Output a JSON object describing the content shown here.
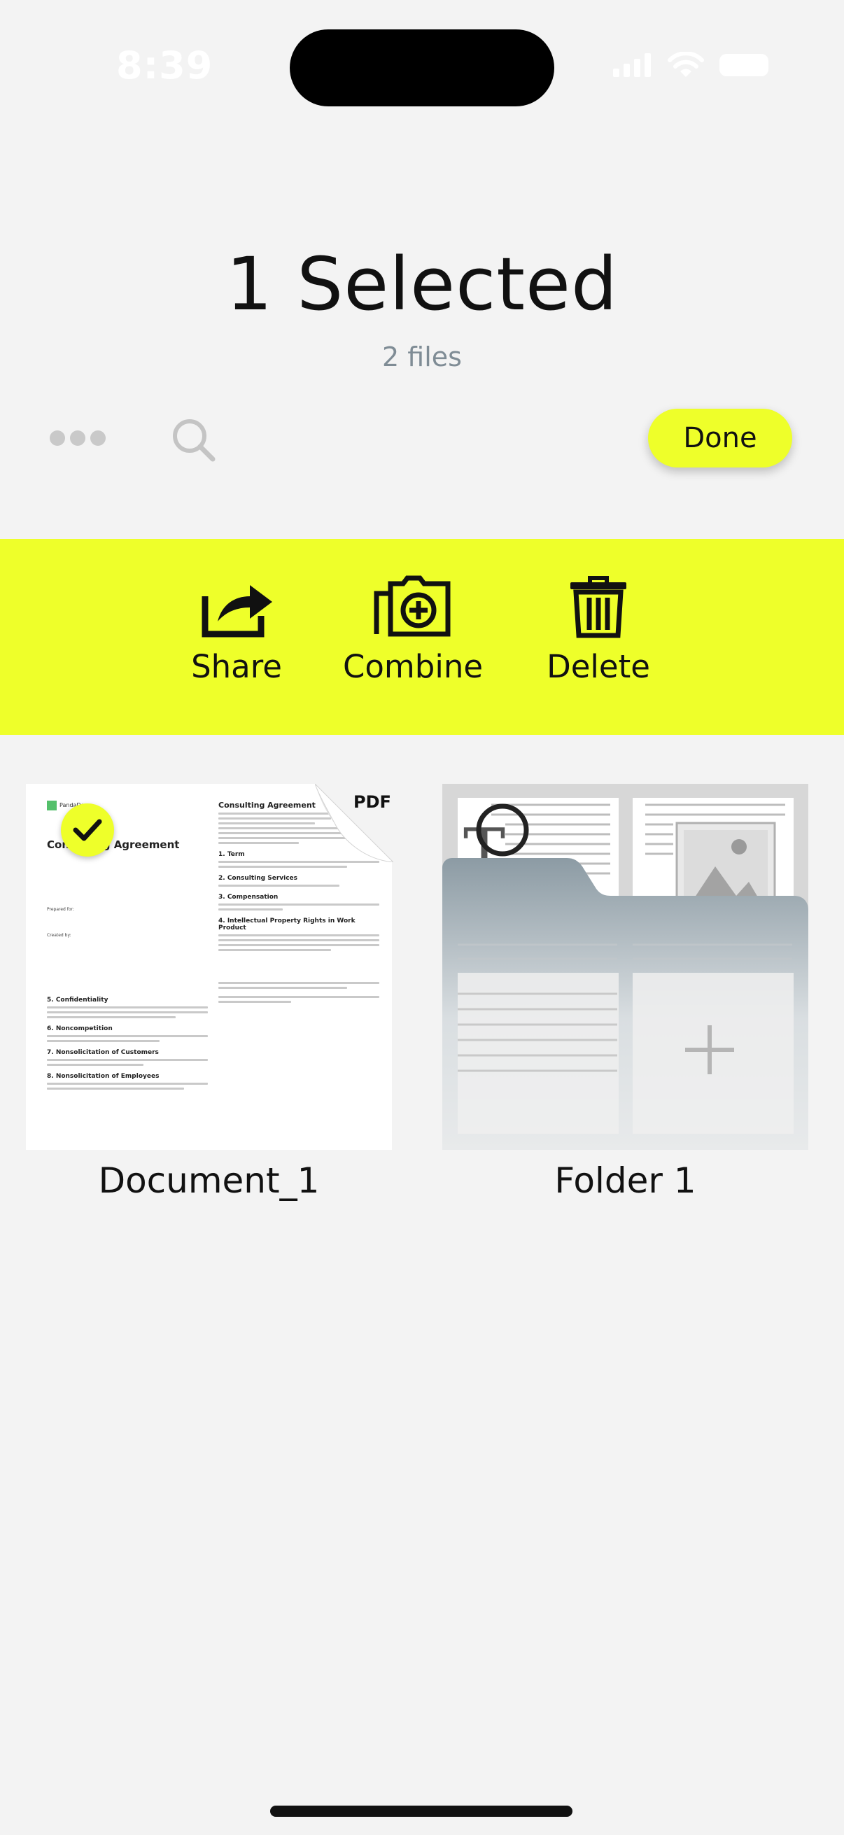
{
  "status_bar": {
    "time": "8:39"
  },
  "header": {
    "title": "1 Selected",
    "subtitle": "2 files"
  },
  "toolbar": {
    "more_icon": "ellipsis-icon",
    "search_icon": "search-icon",
    "done_label": "Done"
  },
  "actions": [
    {
      "label": "Share",
      "icon": "share-icon"
    },
    {
      "label": "Combine",
      "icon": "combine-icon"
    },
    {
      "label": "Delete",
      "icon": "trash-icon"
    }
  ],
  "items": [
    {
      "name": "Document_1",
      "badge": "PDF",
      "selected": true,
      "thumbnail": {
        "logo_text": "PandaDoc",
        "title_left": "Consulting Agreement",
        "prepared_for": "Prepared for:",
        "created_by": "Created by:",
        "title_right": "Consulting Agreement",
        "sections_right": [
          "1. Term",
          "2. Consulting Services",
          "3. Compensation",
          "4. Intellectual Property Rights in Work Product"
        ],
        "sections_left": [
          "5. Confidentiality",
          "6. Noncompetition",
          "7. Nonsolicitation of Customers",
          "8. Nonsolicitation of Employees"
        ]
      }
    },
    {
      "name": "Folder 1"
    }
  ],
  "colors": {
    "accent": "#eeff2a",
    "background": "#f3f3f3",
    "subtitle": "#7f8c95"
  }
}
